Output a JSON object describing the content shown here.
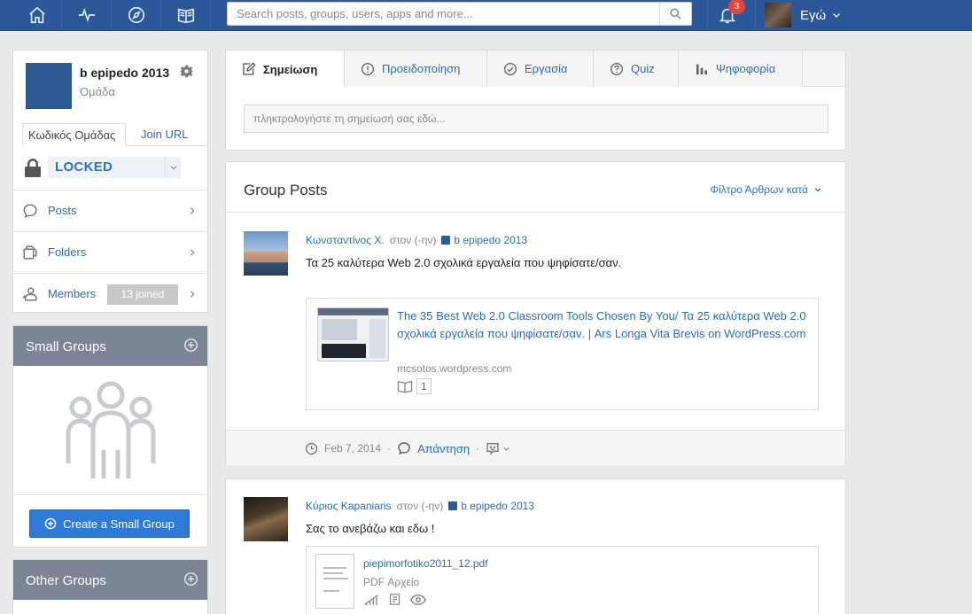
{
  "topbar": {
    "search_placeholder": "Search posts, groups, users, apps and more...",
    "notification_count": "3",
    "user_label": "Εγώ"
  },
  "group": {
    "name": "b epipedo 2013",
    "type": "Ομάδα",
    "tabs": [
      "Κωδικός Ομάδας",
      "Join URL"
    ],
    "lock_value": "LOCKED",
    "menu": [
      {
        "label": "Posts"
      },
      {
        "label": "Folders"
      },
      {
        "label": "Members",
        "badge": "13 joined"
      }
    ]
  },
  "small_groups": {
    "title": "Small Groups",
    "create_label": "Create a Small Group"
  },
  "other_groups": {
    "title": "Other Groups"
  },
  "composer": {
    "tabs": [
      "Σημείωση",
      "Προειδοποίηση",
      "Εργασία",
      "Quiz",
      "Ψηφοφορία"
    ],
    "placeholder": "πληκτρολογήστε τη σημείωσή σας εδώ..."
  },
  "posts_header": {
    "title": "Group Posts",
    "filter_label": "Φίλτρο Άρθρων κατά"
  },
  "posts": [
    {
      "author": "Κωνσταντίνος Χ.",
      "to_text": "στον (-ην)",
      "group": "b epipedo 2013",
      "text": "Τα 25 καλύτερα Web 2.0 σχολικά εργαλεία που ψηφίσατε/σαν.",
      "link_title": "The 35 Best Web 2.0 Classroom Tools Chosen By You/ Τα 25 καλύτερα Web 2.0 σχολικά εργαλεία που ψηφίσατε/σαν. | Ars Longa Vita Brevis on WordPress.com",
      "link_domain": "mcsotos.wordpress.com",
      "link_count": "1",
      "date": "Feb 7, 2014",
      "reply_label": "Απάντηση",
      "separator": "·"
    },
    {
      "author": "Κύριος Kapaniaris",
      "to_text": "στον (-ην)",
      "group": "b epipedo 2013",
      "text": "Σας το ανεβάζω και εδω !",
      "file_name": "piepimorfotiko2011_12.pdf",
      "file_type": "PDF Αρχείο"
    }
  ],
  "colors": {
    "topbar": "#2c5899",
    "link": "#2b6cb8",
    "panel_header": "#7b8595",
    "button": "#2e7ad6",
    "badge": "#e0463a"
  }
}
